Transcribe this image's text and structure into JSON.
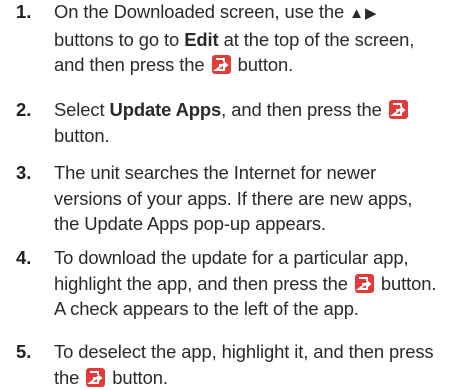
{
  "steps": [
    {
      "number": "1.",
      "parts": {
        "a": "On the Downloaded screen, use the",
        "arrows": "▲▶",
        "b": "buttons to go to",
        "bold": "Edit",
        "c": "at the top of the screen, and then press the",
        "d": "button."
      }
    },
    {
      "number": "2.",
      "parts": {
        "a": "Select",
        "bold": "Update Apps",
        "b": ", and then press the",
        "c": "button."
      }
    },
    {
      "number": "3.",
      "parts": {
        "a": "The unit searches the Internet for newer versions of your apps. If there are new apps, the Update Apps pop-up appears."
      }
    },
    {
      "number": "4.",
      "parts": {
        "a": "To download the update for a particular app, highlight the app, and then press the",
        "b": "button. A check appears to the left of the app."
      }
    },
    {
      "number": "5.",
      "parts": {
        "a": "To deselect the app, highlight it, and then press the",
        "b": "button."
      }
    }
  ],
  "icons": {
    "enter_button_icon": "enter-button-icon",
    "enter_button_color": "#e23b3a"
  }
}
